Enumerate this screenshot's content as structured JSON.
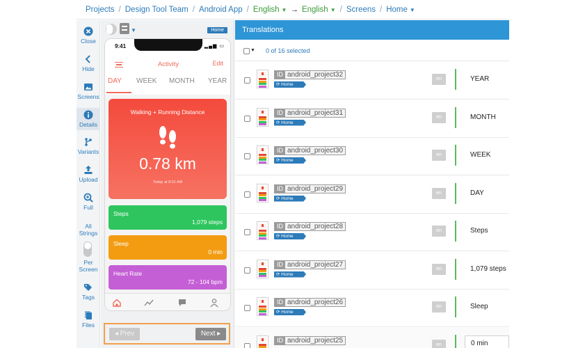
{
  "breadcrumb": {
    "items": [
      "Projects",
      "Design Tool Team",
      "Android App"
    ],
    "source_lang": "English",
    "target_lang": "English",
    "screens": "Screens",
    "screen": "Home"
  },
  "nav": {
    "close": "Close",
    "hide": "Hide",
    "screens": "Screens",
    "details": "Details",
    "variants": "Variants",
    "upload": "Upload",
    "full": "Full",
    "all_strings_1": "All",
    "all_strings_2": "Strings",
    "per_screen_1": "Per",
    "per_screen_2": "Screen",
    "tags": "Tags",
    "files": "Files"
  },
  "preview": {
    "badge": "Home",
    "prev": "Prev",
    "next": "Next"
  },
  "app": {
    "time": "9:41",
    "title": "Activity",
    "edit": "Edit",
    "tabs": [
      "DAY",
      "WEEK",
      "MONTH",
      "YEAR"
    ],
    "main_card": {
      "title": "Walking + Running Distance",
      "value": "0.78 km",
      "subtitle": "Today at 8:31 AM"
    },
    "cards": [
      {
        "name": "Steps",
        "value": "1,079 steps",
        "color": "#2ec55e"
      },
      {
        "name": "Sleep",
        "value": "0 min",
        "color": "#f39c12"
      },
      {
        "name": "Heart Rate",
        "value": "72 - 104 bpm",
        "color": "#c55fd6"
      }
    ],
    "accent": "#ef6b5b"
  },
  "translations": {
    "header": "Translations",
    "selected": "0 of 16 selected",
    "rows": [
      {
        "id_label": "ID",
        "key": "android_project32",
        "tag": "Home",
        "lang": "en",
        "text": "YEAR"
      },
      {
        "id_label": "ID",
        "key": "android_project31",
        "tag": "Home",
        "lang": "en",
        "text": "MONTH"
      },
      {
        "id_label": "ID",
        "key": "android_project30",
        "tag": "Home",
        "lang": "en",
        "text": "WEEK"
      },
      {
        "id_label": "ID",
        "key": "android_project29",
        "tag": "Home",
        "lang": "en",
        "text": "DAY"
      },
      {
        "id_label": "ID",
        "key": "android_project28",
        "tag": "Home",
        "lang": "en",
        "text": "Steps"
      },
      {
        "id_label": "ID",
        "key": "android_project27",
        "tag": "Home",
        "lang": "en",
        "text": "1,079 steps"
      },
      {
        "id_label": "ID",
        "key": "android_project26",
        "tag": "Home",
        "lang": "en",
        "text": "Sleep"
      },
      {
        "id_label": "ID",
        "key": "android_project25",
        "tag": "",
        "lang": "en",
        "text": "0 min"
      }
    ]
  },
  "colors": {
    "link": "#2d7bb9",
    "header": "#2e95d6",
    "highlight": "#f0a04b",
    "approved": "#5cb85c"
  }
}
